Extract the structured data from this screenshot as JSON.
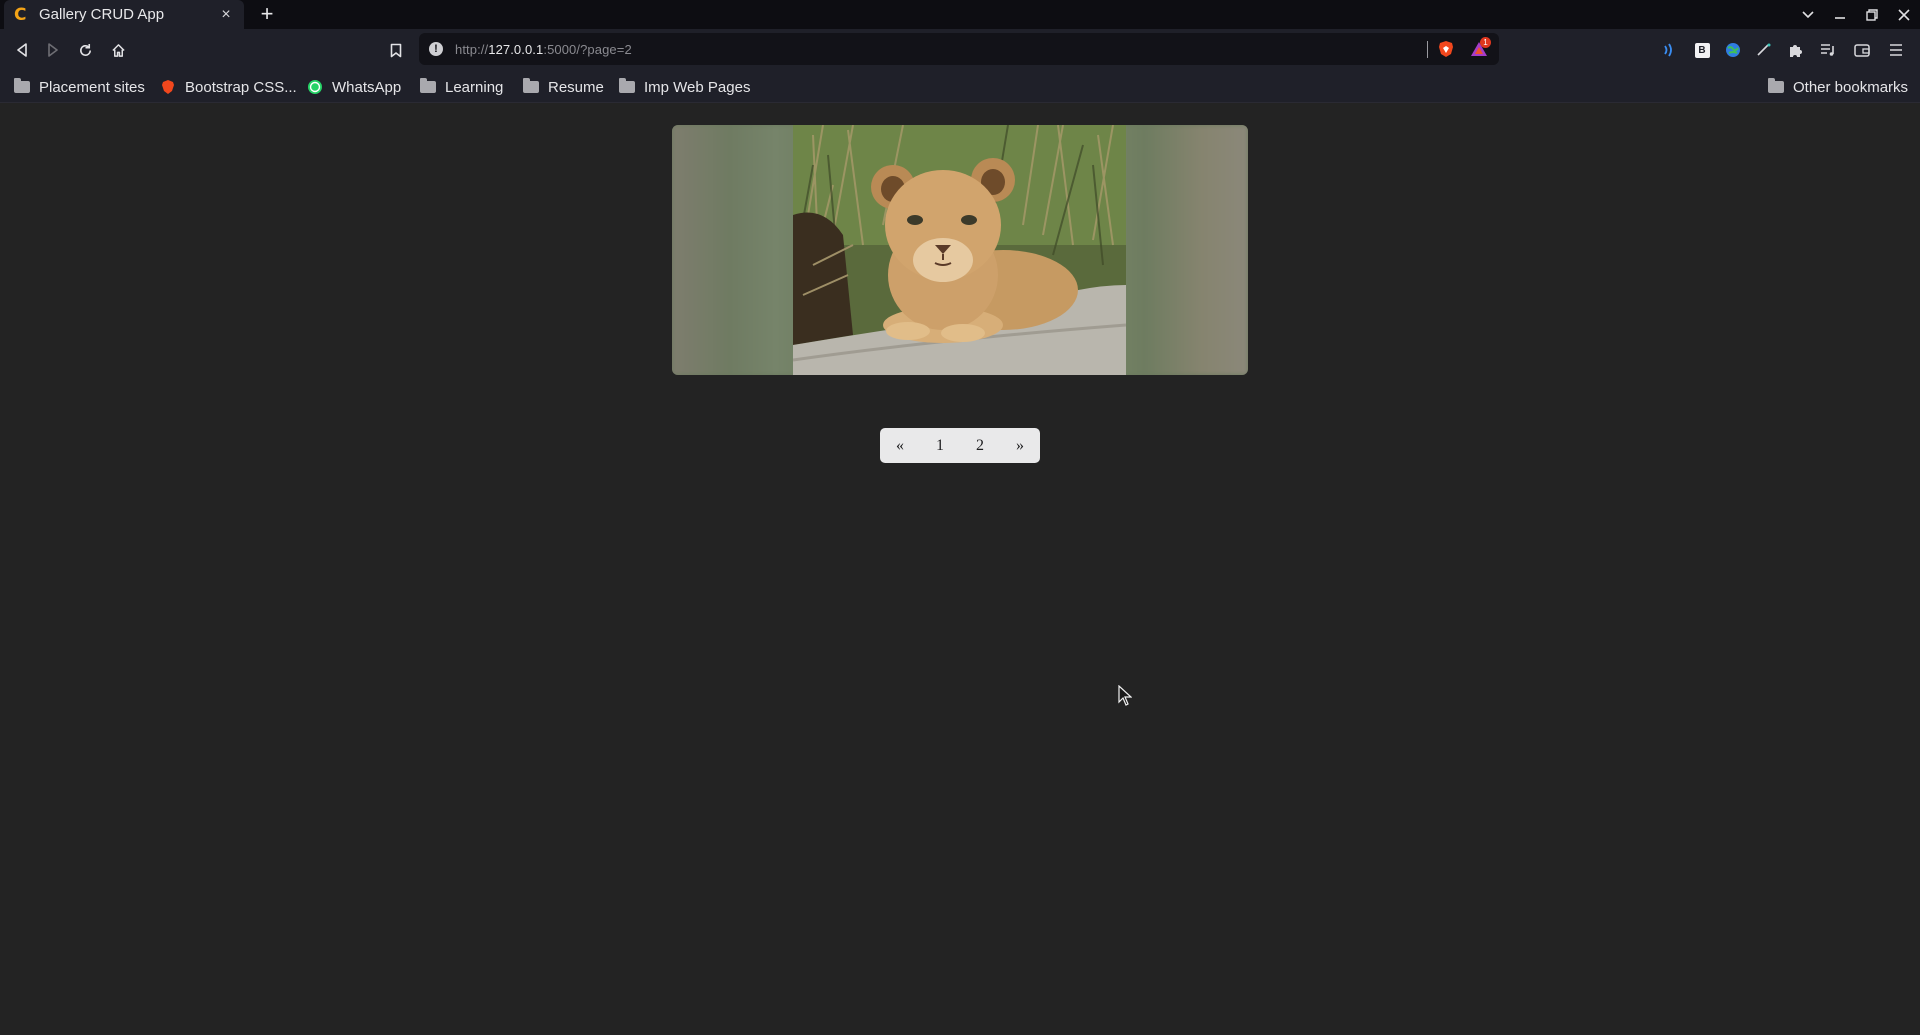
{
  "browser": {
    "tab": {
      "title": "Gallery CRUD App",
      "favicon_glyph": "C",
      "close_glyph": "×"
    },
    "new_tab_glyph": "+",
    "url": {
      "scheme": "http://",
      "host": "127.0.0.1",
      "rest": ":5000/?page=2"
    },
    "rewards_badge_count": "1",
    "extension_letter": "B"
  },
  "bookmarks": [
    {
      "label": "Placement sites",
      "icon": "folder-icon"
    },
    {
      "label": "Bootstrap CSS...",
      "icon": "brave-favicon"
    },
    {
      "label": "WhatsApp",
      "icon": "whatsapp-icon"
    },
    {
      "label": "Learning",
      "icon": "folder-icon"
    },
    {
      "label": "Resume",
      "icon": "folder-icon"
    },
    {
      "label": "Imp Web Pages",
      "icon": "folder-icon"
    }
  ],
  "other_bookmarks": "Other bookmarks",
  "gallery": {
    "image_subject": "lion cub lying on a rock"
  },
  "pagination": {
    "prev": "«",
    "pages": [
      "1",
      "2"
    ],
    "next": "»",
    "current_page": 2
  },
  "colors": {
    "page_background": "#232323",
    "chrome_background": "#1f2029",
    "tab_accent": "#f3a316"
  }
}
